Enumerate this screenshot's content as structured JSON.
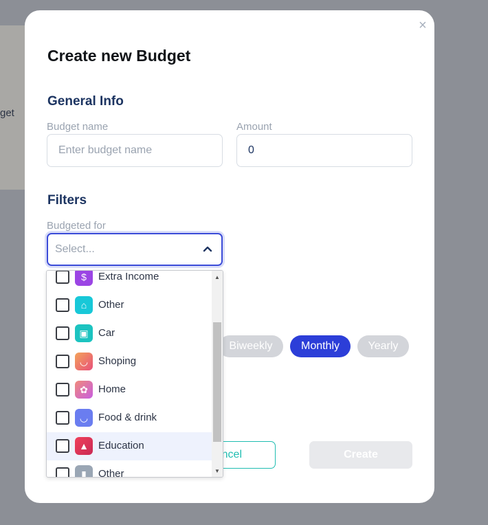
{
  "background": {
    "fragment_text": "get"
  },
  "modal": {
    "title": "Create new Budget",
    "close_icon": "×"
  },
  "general_info": {
    "heading": "General Info",
    "budget_name_label": "Budget name",
    "budget_name_placeholder": "Enter budget name",
    "amount_label": "Amount",
    "amount_value": "0"
  },
  "filters": {
    "heading": "Filters",
    "budgeted_for_label": "Budgeted for",
    "select_placeholder": "Select..."
  },
  "dropdown": {
    "options": [
      {
        "label": "Extra Income",
        "icon": "money-bag-icon",
        "color": "#9b45e4",
        "glyph": "$"
      },
      {
        "label": "Other",
        "icon": "bank-icon",
        "color": "#18c8d8",
        "glyph": "⌂"
      },
      {
        "label": "Car",
        "icon": "car-icon",
        "color": "#1cc3c0",
        "glyph": "▣"
      },
      {
        "label": "Shoping",
        "icon": "basket-icon",
        "color": "#ef6a5b",
        "glyph": "◡"
      },
      {
        "label": "Home",
        "icon": "paw-icon",
        "color": "#e06bb0",
        "glyph": "✿"
      },
      {
        "label": "Food & drink",
        "icon": "basket-icon",
        "color": "#6a7df0",
        "glyph": "◡"
      },
      {
        "label": "Education",
        "icon": "graduation-cap-icon",
        "color": "#e23a5a",
        "glyph": "▲"
      },
      {
        "label": "Other",
        "icon": "trash-icon",
        "color": "#9aa6b4",
        "glyph": "▮"
      }
    ],
    "highlighted_index": 6
  },
  "period": {
    "options": [
      "Biweekly",
      "Monthly",
      "Yearly"
    ],
    "selected": "Monthly"
  },
  "actions": {
    "cancel_label": "ncel",
    "create_label": "Create"
  },
  "colors": {
    "accent": "#2c3ed8",
    "teal": "#1fbdb1",
    "heading": "#1c3461"
  }
}
